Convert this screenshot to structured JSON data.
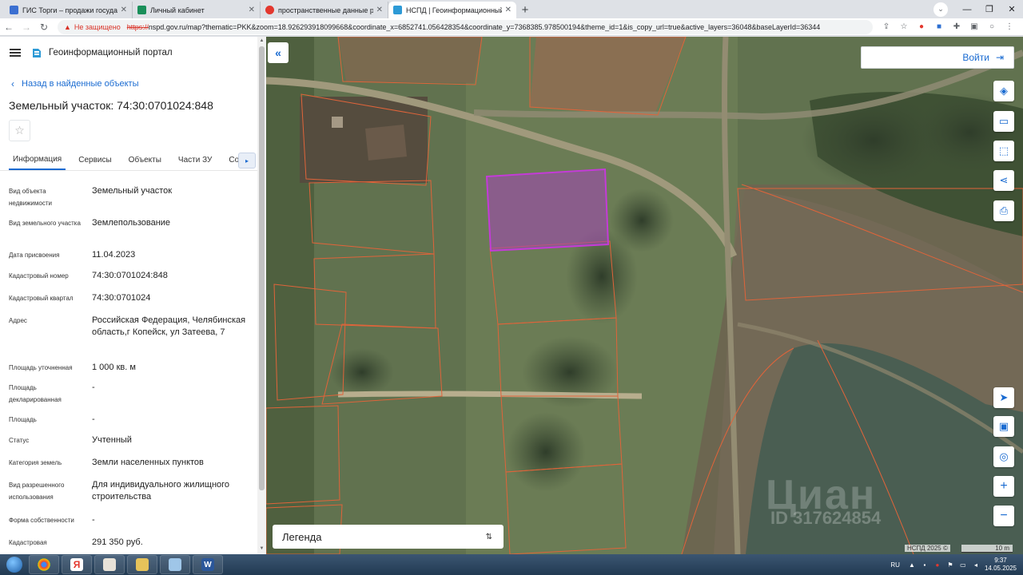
{
  "browser": {
    "tabs": [
      {
        "title": "ГИС Торги – продажи государств",
        "color": "#3b6fd1",
        "active": false
      },
      {
        "title": "Личный кабинет",
        "color": "#1a8f5a",
        "active": false
      },
      {
        "title": "пространственные данные росс",
        "color": "#e3372e",
        "active": false
      },
      {
        "title": "НСПД | Геоинформационный п",
        "color": "#2d9ad6",
        "active": true
      }
    ],
    "new_tab": "+",
    "not_secure": "Не защищено",
    "url_scheme": "https://",
    "url_rest": "nspd.gov.ru/map?thematic=PKK&zoom=18.926293918099668&coordinate_x=6852741.056428354&coordinate_y=7368385.978500194&theme_id=1&is_copy_url=true&active_layers=36048&baseLayerId=36344"
  },
  "panel": {
    "portal_name": "Геоинформационный портал",
    "back_label": "Назад в найденные объекты",
    "title": "Земельный участок: 74:30:0701024:848",
    "tabs": [
      "Информация",
      "Сервисы",
      "Объекты",
      "Части ЗУ",
      "Соста"
    ],
    "attributes": [
      {
        "k": "Вид объекта недвижимости",
        "v": "Земельный участок"
      },
      {
        "k": "Вид земельного участка",
        "v": "Землепользование"
      },
      {
        "k": "Дата присвоения",
        "v": "11.04.2023"
      },
      {
        "k": "Кадастровый номер",
        "v": "74:30:0701024:848"
      },
      {
        "k": "Кадастровый квартал",
        "v": "74:30:0701024"
      },
      {
        "k": "Адрес",
        "v": "Российская Федерация, Челябинская область,г Копейск, ул Затеева, 7"
      },
      {
        "k": "Площадь уточненная",
        "v": "1 000 кв. м"
      },
      {
        "k": "Площадь декларированная",
        "v": "-"
      },
      {
        "k": "Площадь",
        "v": "-"
      },
      {
        "k": "Статус",
        "v": "Учтенный"
      },
      {
        "k": "Категория земель",
        "v": "Земли населенных пунктов"
      },
      {
        "k": "Вид разрешенного использования",
        "v": "Для индивидуального жилищного строительства"
      },
      {
        "k": "Форма собственности",
        "v": "-"
      },
      {
        "k": "Кадастровая",
        "v": "291 350 руб."
      }
    ]
  },
  "map": {
    "login_label": "Войти",
    "legend_label": "Легенда",
    "watermark": "Циан",
    "watermark_id": "ID 317624854",
    "copyright": "НСПД 2025 ©",
    "scale_label": "10 m",
    "colors": {
      "parcel_border": "#e0643a",
      "selected_parcel": "#b43bc8",
      "accent": "#1a6bd1"
    }
  },
  "taskbar": {
    "lang": "RU",
    "time": "9:37",
    "date": "14.05.2025",
    "apps": [
      "ie",
      "chrome",
      "yandex",
      "java",
      "files",
      "pen",
      "word"
    ]
  }
}
